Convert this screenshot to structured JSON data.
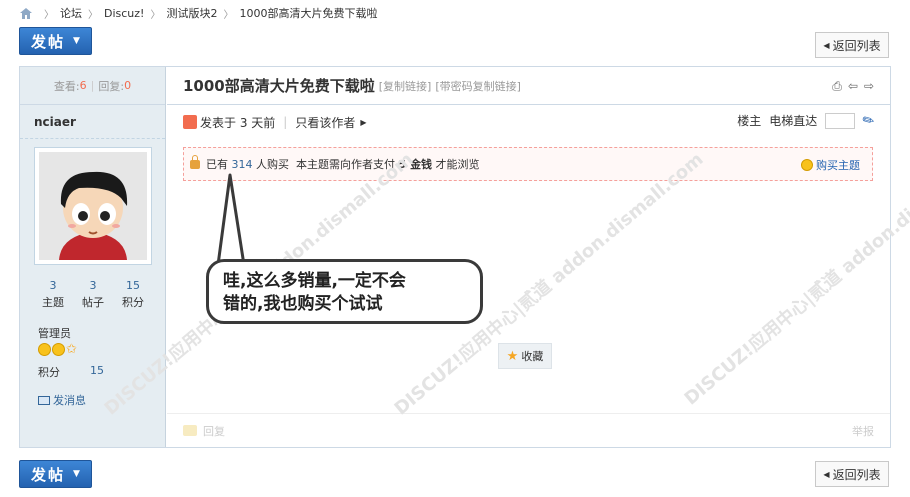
{
  "breadcrumb": {
    "items": [
      "论坛",
      "Discuz!",
      "测试版块2",
      "1000部高清大片免费下载啦"
    ]
  },
  "buttons": {
    "post_label": "发帖",
    "back_label": "返回列表"
  },
  "sidebar": {
    "views_label": "查看:",
    "views_value": "6",
    "replies_label": "回复:",
    "replies_value": "0",
    "author": "nciaer",
    "stats": [
      {
        "value": "3",
        "label": "主题"
      },
      {
        "value": "3",
        "label": "帖子"
      },
      {
        "value": "15",
        "label": "积分"
      }
    ],
    "group": "管理员",
    "points_label": "积分",
    "points_value": "15",
    "message_label": "发消息"
  },
  "post": {
    "title": "1000部高清大片免费下载啦",
    "copy_link": "[复制链接]",
    "copy_pw_link": "[带密码复制链接]",
    "posted": "发表于 3 天前",
    "only_author": "只看该作者",
    "floor": "楼主",
    "jump_label": "电梯直达",
    "buy_prefix": "已有",
    "buy_count": "314",
    "buy_suffix": "人购买",
    "buy_notice_a": "本主题需向作者支付",
    "buy_price": "5 金钱",
    "buy_notice_b": "才能浏览",
    "buy_button": "购买主题",
    "favorite_label": "收藏",
    "reply_label": "回复",
    "report_label": "举报"
  },
  "annotation": {
    "line1": "哇,这么多销量,一定不会",
    "line2": "错的,我也购买个试试"
  },
  "watermark": "DISCUZ!应用中心|贰道 addon.dismall.com"
}
